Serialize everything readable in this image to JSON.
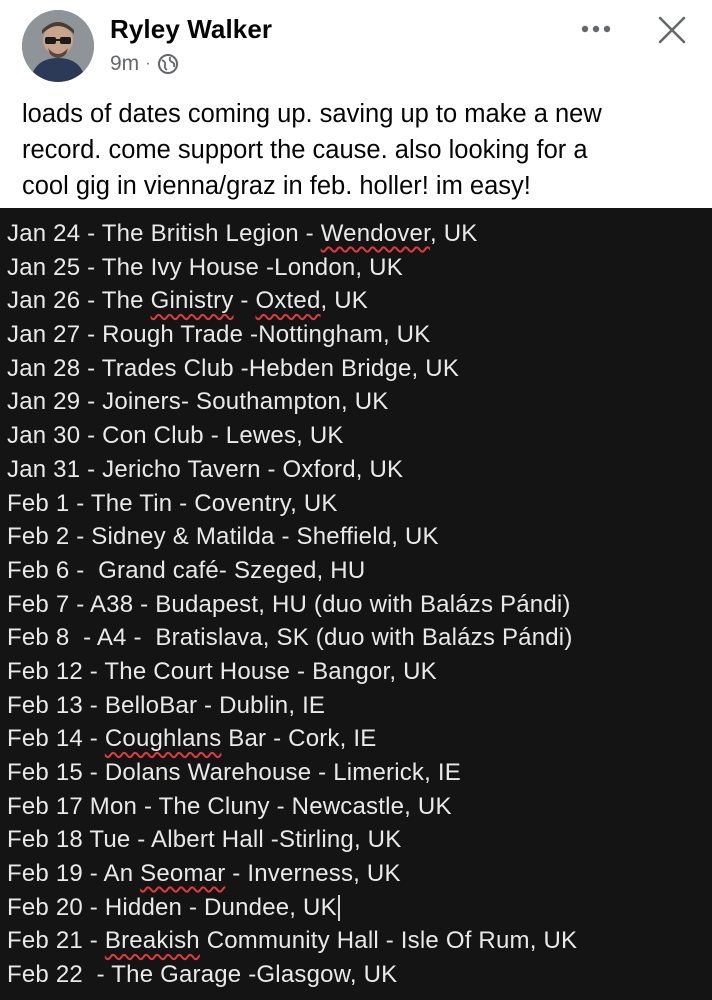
{
  "header": {
    "author_name": "Ryley Walker",
    "timestamp": "9m",
    "separator": "·",
    "privacy_icon": "globe-icon",
    "more_icon": "more-dots-icon",
    "close_icon": "close-x-icon"
  },
  "post": {
    "text_lines": [
      "loads of dates coming up. saving up to make a new",
      "record. come support the cause. also looking for a",
      "cool gig in vienna/graz in feb. holler! im easy!"
    ]
  },
  "tour_image": {
    "lines": [
      [
        {
          "t": "Jan 24 - The British Legion - "
        },
        {
          "t": "Wendover",
          "sq": true
        },
        {
          "t": ", UK"
        }
      ],
      [
        {
          "t": "Jan 25 - The Ivy House -London, UK"
        }
      ],
      [
        {
          "t": "Jan 26 - The "
        },
        {
          "t": "Ginistry",
          "sq": true
        },
        {
          "t": " - "
        },
        {
          "t": "Oxted",
          "sq": true
        },
        {
          "t": ", UK"
        }
      ],
      [
        {
          "t": "Jan 27 - Rough Trade -Nottingham, UK"
        }
      ],
      [
        {
          "t": "Jan 28 - Trades Club -Hebden Bridge, UK"
        }
      ],
      [
        {
          "t": "Jan 29 - Joiners- Southampton, UK"
        }
      ],
      [
        {
          "t": "Jan 30 - Con Club - Lewes, UK"
        }
      ],
      [
        {
          "t": "Jan 31 - Jericho Tavern - Oxford, UK"
        }
      ],
      [
        {
          "t": "Feb 1 - The Tin - Coventry, UK"
        }
      ],
      [
        {
          "t": "Feb 2 - Sidney & Matilda - Sheffield, UK"
        }
      ],
      [
        {
          "t": "Feb 6 -  Grand café- Szeged, HU"
        }
      ],
      [
        {
          "t": "Feb 7 - A38 - Budapest, HU (duo with Balázs Pándi)"
        }
      ],
      [
        {
          "t": "Feb 8  - A4 -  Bratislava, SK (duo with Balázs Pándi)"
        }
      ],
      [
        {
          "t": "Feb 12 - The Court House - Bangor, UK"
        }
      ],
      [
        {
          "t": "Feb 13 - BelloBar - Dublin, IE"
        }
      ],
      [
        {
          "t": "Feb 14 - "
        },
        {
          "t": "Coughlans",
          "sq": true
        },
        {
          "t": " Bar - Cork, IE"
        }
      ],
      [
        {
          "t": "Feb 15 - Dolans Warehouse - Limerick, IE"
        }
      ],
      [
        {
          "t": "Feb 17 Mon - The Cluny - Newcastle, UK"
        }
      ],
      [
        {
          "t": "Feb 18 Tue - Albert Hall -Stirling, UK"
        }
      ],
      [
        {
          "t": "Feb 19 - An "
        },
        {
          "t": "Seomar",
          "sq": true
        },
        {
          "t": " - Inverness, UK"
        }
      ],
      [
        {
          "t": "Feb 20 - Hidden - Dundee, UK"
        },
        {
          "caret": true
        }
      ],
      [
        {
          "t": "Feb 21 - "
        },
        {
          "t": "Breakish",
          "sq": true
        },
        {
          "t": " Community Hall - Isle Of Rum, UK"
        }
      ],
      [
        {
          "t": "Feb 22  - The Garage -Glasgow, UK"
        }
      ]
    ]
  },
  "colors": {
    "spellcheck_underline": "#e03b3b",
    "image_background": "#141414",
    "image_text": "#e9e9e9",
    "meta_text": "#65676b"
  }
}
